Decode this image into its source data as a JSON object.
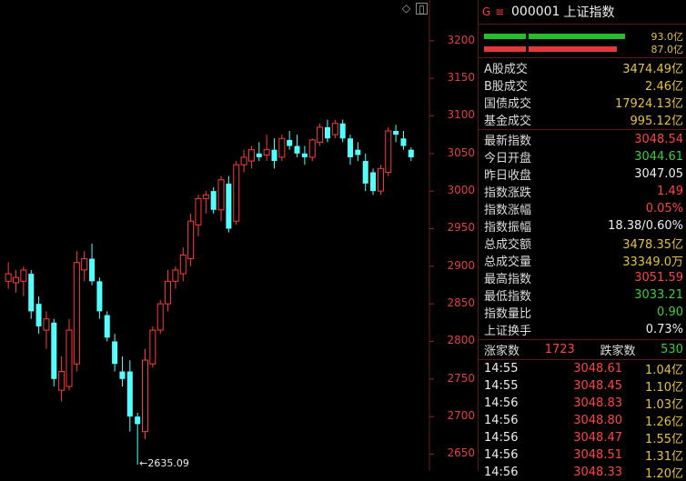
{
  "header": {
    "g_label": "G",
    "menu_icon": "menu-icon",
    "code": "000001",
    "name": "上证指数"
  },
  "bars": [
    {
      "label": "93.0亿",
      "color": "#22c02a",
      "fill": [
        0.2,
        0.62
      ]
    },
    {
      "label": "87.0亿",
      "color": "#e03a3a",
      "fill": [
        0.2,
        0.58
      ]
    }
  ],
  "turnover": [
    {
      "label": "A股成交",
      "value": "3474.49亿",
      "color": "#e6c23a"
    },
    {
      "label": "B股成交",
      "value": "2.46亿",
      "color": "#e6c23a"
    },
    {
      "label": "国债成交",
      "value": "17924.13亿",
      "color": "#e6c23a"
    },
    {
      "label": "基金成交",
      "value": "995.12亿",
      "color": "#e6c23a"
    }
  ],
  "stats": [
    {
      "label": "最新指数",
      "value": "3048.54",
      "color": "#ff4444"
    },
    {
      "label": "今日开盘",
      "value": "3044.61",
      "color": "#3ccc3c"
    },
    {
      "label": "昨日收盘",
      "value": "3047.05",
      "color": "#eeeeee"
    },
    {
      "label": "指数涨跌",
      "value": "1.49",
      "color": "#ff4444"
    },
    {
      "label": "指数涨幅",
      "value": "0.05%",
      "color": "#ff4444"
    },
    {
      "label": "指数振幅",
      "value": "18.38/0.60%",
      "color": "#eeeeee"
    },
    {
      "label": "总成交额",
      "value": "3478.35亿",
      "color": "#e6c23a"
    },
    {
      "label": "总成交量",
      "value": "33349.0万",
      "color": "#e6c23a"
    },
    {
      "label": "最高指数",
      "value": "3051.59",
      "color": "#ff4444"
    },
    {
      "label": "最低指数",
      "value": "3033.21",
      "color": "#3ccc3c"
    },
    {
      "label": "指数量比",
      "value": "0.90",
      "color": "#3ccc3c"
    },
    {
      "label": "上证换手",
      "value": "0.73%",
      "color": "#eeeeee"
    }
  ],
  "breadth": {
    "up_label": "涨家数",
    "up_value": "1723",
    "down_label": "跌家数",
    "down_value": "530"
  },
  "ticks": [
    {
      "time": "14:55",
      "price": "3048.61",
      "amount": "1.04亿"
    },
    {
      "time": "14:55",
      "price": "3048.45",
      "amount": "1.10亿"
    },
    {
      "time": "14:56",
      "price": "3048.83",
      "amount": "1.03亿"
    },
    {
      "time": "14:56",
      "price": "3048.80",
      "amount": "1.26亿"
    },
    {
      "time": "14:56",
      "price": "3048.47",
      "amount": "1.55亿"
    },
    {
      "time": "14:56",
      "price": "3048.51",
      "amount": "1.31亿"
    },
    {
      "time": "14:56",
      "price": "3048.33",
      "amount": "1.20亿"
    }
  ],
  "chart_data": {
    "type": "candlestick",
    "y_ticks": [
      3200,
      3150,
      3100,
      3050,
      3000,
      2950,
      2900,
      2850,
      2800,
      2750,
      2700,
      2650
    ],
    "ylim": [
      2630,
      3230
    ],
    "low_annotation": "2635.09",
    "candles": [
      {
        "o": 2880,
        "h": 2905,
        "l": 2870,
        "c": 2890
      },
      {
        "o": 2878,
        "h": 2895,
        "l": 2865,
        "c": 2885
      },
      {
        "o": 2880,
        "h": 2900,
        "l": 2860,
        "c": 2895
      },
      {
        "o": 2890,
        "h": 2895,
        "l": 2830,
        "c": 2840
      },
      {
        "o": 2850,
        "h": 2860,
        "l": 2810,
        "c": 2820
      },
      {
        "o": 2815,
        "h": 2840,
        "l": 2790,
        "c": 2830
      },
      {
        "o": 2825,
        "h": 2830,
        "l": 2740,
        "c": 2750
      },
      {
        "o": 2735,
        "h": 2780,
        "l": 2720,
        "c": 2760
      },
      {
        "o": 2740,
        "h": 2830,
        "l": 2735,
        "c": 2815
      },
      {
        "o": 2770,
        "h": 2920,
        "l": 2760,
        "c": 2905
      },
      {
        "o": 2895,
        "h": 2920,
        "l": 2880,
        "c": 2910
      },
      {
        "o": 2910,
        "h": 2930,
        "l": 2875,
        "c": 2880
      },
      {
        "o": 2880,
        "h": 2885,
        "l": 2830,
        "c": 2840
      },
      {
        "o": 2835,
        "h": 2840,
        "l": 2800,
        "c": 2805
      },
      {
        "o": 2800,
        "h": 2810,
        "l": 2760,
        "c": 2770
      },
      {
        "o": 2760,
        "h": 2780,
        "l": 2740,
        "c": 2750
      },
      {
        "o": 2760,
        "h": 2775,
        "l": 2680,
        "c": 2700
      },
      {
        "o": 2700,
        "h": 2705,
        "l": 2636,
        "c": 2690
      },
      {
        "o": 2680,
        "h": 2790,
        "l": 2670,
        "c": 2775
      },
      {
        "o": 2770,
        "h": 2820,
        "l": 2765,
        "c": 2815
      },
      {
        "o": 2815,
        "h": 2855,
        "l": 2810,
        "c": 2850
      },
      {
        "o": 2850,
        "h": 2895,
        "l": 2840,
        "c": 2880
      },
      {
        "o": 2880,
        "h": 2900,
        "l": 2870,
        "c": 2895
      },
      {
        "o": 2890,
        "h": 2925,
        "l": 2880,
        "c": 2915
      },
      {
        "o": 2910,
        "h": 2970,
        "l": 2900,
        "c": 2960
      },
      {
        "o": 2955,
        "h": 2995,
        "l": 2940,
        "c": 2990
      },
      {
        "o": 2990,
        "h": 3000,
        "l": 2970,
        "c": 2995
      },
      {
        "o": 3000,
        "h": 3005,
        "l": 2970,
        "c": 2975
      },
      {
        "o": 2975,
        "h": 3020,
        "l": 2960,
        "c": 3015
      },
      {
        "o": 3010,
        "h": 3020,
        "l": 2945,
        "c": 2950
      },
      {
        "o": 2960,
        "h": 3040,
        "l": 2955,
        "c": 3035
      },
      {
        "o": 3035,
        "h": 3055,
        "l": 3025,
        "c": 3045
      },
      {
        "o": 3040,
        "h": 3060,
        "l": 3030,
        "c": 3055
      },
      {
        "o": 3050,
        "h": 3065,
        "l": 3040,
        "c": 3045
      },
      {
        "o": 3048,
        "h": 3075,
        "l": 3040,
        "c": 3055
      },
      {
        "o": 3055,
        "h": 3070,
        "l": 3030,
        "c": 3040
      },
      {
        "o": 3045,
        "h": 3075,
        "l": 3040,
        "c": 3070
      },
      {
        "o": 3068,
        "h": 3080,
        "l": 3055,
        "c": 3060
      },
      {
        "o": 3060,
        "h": 3075,
        "l": 3045,
        "c": 3050
      },
      {
        "o": 3050,
        "h": 3060,
        "l": 3035,
        "c": 3045
      },
      {
        "o": 3045,
        "h": 3070,
        "l": 3040,
        "c": 3068
      },
      {
        "o": 3065,
        "h": 3090,
        "l": 3060,
        "c": 3085
      },
      {
        "o": 3085,
        "h": 3095,
        "l": 3065,
        "c": 3070
      },
      {
        "o": 3075,
        "h": 3095,
        "l": 3070,
        "c": 3090
      },
      {
        "o": 3090,
        "h": 3095,
        "l": 3065,
        "c": 3070
      },
      {
        "o": 3070,
        "h": 3075,
        "l": 3035,
        "c": 3045
      },
      {
        "o": 3055,
        "h": 3065,
        "l": 3040,
        "c": 3048
      },
      {
        "o": 3040,
        "h": 3050,
        "l": 3000,
        "c": 3010
      },
      {
        "o": 3025,
        "h": 3030,
        "l": 2995,
        "c": 3000
      },
      {
        "o": 3000,
        "h": 3035,
        "l": 2995,
        "c": 3030
      },
      {
        "o": 3025,
        "h": 3085,
        "l": 3020,
        "c": 3080
      },
      {
        "o": 3080,
        "h": 3088,
        "l": 3065,
        "c": 3075
      },
      {
        "o": 3070,
        "h": 3080,
        "l": 3055,
        "c": 3060
      },
      {
        "o": 3055,
        "h": 3058,
        "l": 3040,
        "c": 3045
      }
    ]
  }
}
